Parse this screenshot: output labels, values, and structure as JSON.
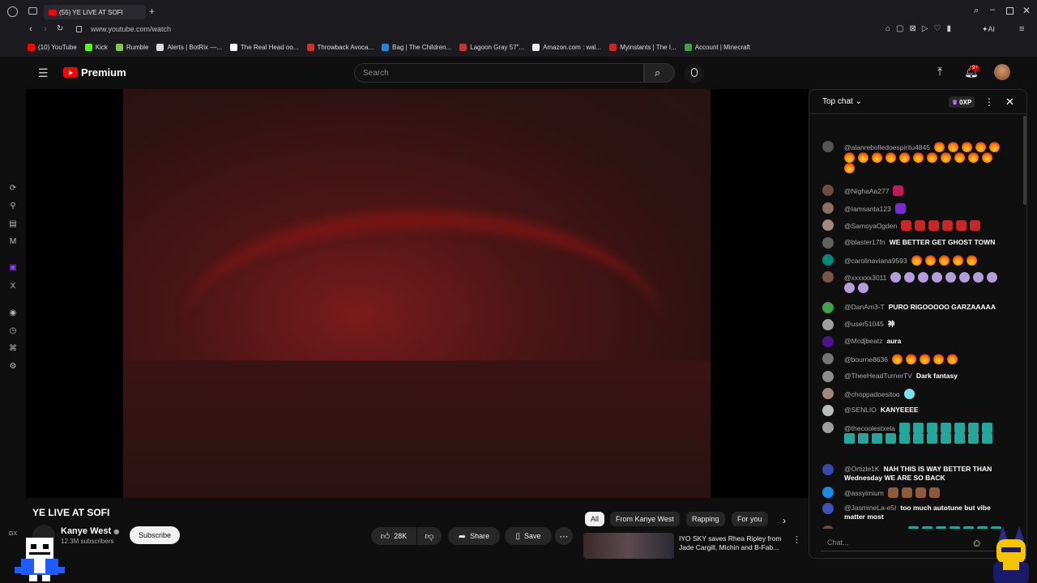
{
  "browser": {
    "tab_title": "(55) YE LIVE AT SOFI",
    "url": "www.youtube.com/watch",
    "bookmarks": [
      {
        "label": "(10) YouTube",
        "color": "#ff0000"
      },
      {
        "label": "Kick",
        "color": "#53fc18"
      },
      {
        "label": "Rumble",
        "color": "#85c742"
      },
      {
        "label": "Alerts | BotRix —...",
        "color": "#dddddd"
      },
      {
        "label": "The Real Head oo...",
        "color": "#ffffff"
      },
      {
        "label": "Throwback Avoca...",
        "color": "#d32f2f"
      },
      {
        "label": "Bag | The Children...",
        "color": "#1e88e5"
      },
      {
        "label": "Lagoon Gray 57\"...",
        "color": "#d32f2f"
      },
      {
        "label": "Amazon.com : wal...",
        "color": "#eeeeee"
      },
      {
        "label": "Myinstants | The I...",
        "color": "#c62828"
      },
      {
        "label": "Account | Minecraft",
        "color": "#43a047"
      }
    ]
  },
  "youtube": {
    "logo_label": "Premium",
    "search_placeholder": "Search",
    "notifications_badge": "9+"
  },
  "video": {
    "title": "YE LIVE AT SOFI",
    "channel": "Kanye West",
    "subscribers": "12.3M subscribers",
    "subscribe_label": "Subscribe",
    "likes": "28K",
    "share_label": "Share",
    "save_label": "Save"
  },
  "chips": [
    "All",
    "From Kanye West",
    "Rapping",
    "For you"
  ],
  "recommended": {
    "title": "IYO SKY saves Rhea Ripley from Jade Cargill, Michin and B-Fab..."
  },
  "chat": {
    "header": "Top chat",
    "xp": "0XP",
    "input_placeholder": "Chat...",
    "messages": [
      {
        "author": "@alanrebolledoespiritu4845",
        "text": "",
        "emoji": "fire",
        "count": 17,
        "avatar": "#555555"
      },
      {
        "author": "@NighaAa277",
        "text": "",
        "emoji": "pink",
        "count": 1,
        "avatar": "#6d4c41"
      },
      {
        "author": "@Iamsanta123",
        "text": "",
        "emoji": "purple",
        "count": 1,
        "avatar": "#8d6e63"
      },
      {
        "author": "@SamoyaOgden",
        "text": "",
        "emoji": "redface",
        "count": 6,
        "avatar": "#a1887f"
      },
      {
        "author": "@blaster17fn",
        "text": "WE BETTER GET GHOST TOWN",
        "emoji": "",
        "count": 0,
        "avatar": "#616161"
      },
      {
        "author": "@carolinaviana9593",
        "text": "",
        "emoji": "fire",
        "count": 5,
        "avatar": "#00897b"
      },
      {
        "author": "@xxxxxx3011",
        "text": "",
        "emoji": "gear",
        "count": 10,
        "avatar": "#795548"
      },
      {
        "author": "@DanAm3-T",
        "text": "PURO RIGOOOOO GARZAAAAA",
        "emoji": "",
        "count": 0,
        "avatar": "#43a047"
      },
      {
        "author": "@user51045",
        "text": "神",
        "emoji": "",
        "count": 0,
        "avatar": "#9e9e9e"
      },
      {
        "author": "@Mcdjbeatz",
        "text": "aura",
        "emoji": "",
        "count": 0,
        "avatar": "#4a148c"
      },
      {
        "author": "@bourne8636",
        "text": "",
        "emoji": "fire",
        "count": 5,
        "avatar": "#757575"
      },
      {
        "author": "@TheeHeadTurnerTV",
        "text": "Dark fantasy",
        "emoji": "",
        "count": 0,
        "avatar": "#8d8d8d"
      },
      {
        "author": "@choppadoesitoo",
        "text": "",
        "emoji": "ice",
        "count": 1,
        "avatar": "#a1887f"
      },
      {
        "author": "@SENLIO",
        "text": "KANYEEEE",
        "emoji": "",
        "count": 0,
        "avatar": "#bdbdbd"
      },
      {
        "author": "@thecoolestxela",
        "text": "",
        "emoji": "dino",
        "count": 18,
        "avatar": "#9e9e9e"
      },
      {
        "author": "@Ortizle1K",
        "text": "NAH THIS IS WAY BETTER THAN Wednesday WE ARE SO BACK",
        "emoji": "",
        "count": 0,
        "avatar": "#3949ab"
      },
      {
        "author": "@assyimium",
        "text": "",
        "emoji": "hand",
        "count": 4,
        "avatar": "#1e88e5"
      },
      {
        "author": "@JasmineLa-e5I",
        "text": "too much autotune but vibe matter most",
        "emoji": "",
        "count": 0,
        "avatar": "#3f51b5"
      },
      {
        "author": "@CRUNCHHTRAP",
        "text": "",
        "emoji": "dino",
        "count": 12,
        "avatar": "#6d4c41"
      }
    ]
  }
}
